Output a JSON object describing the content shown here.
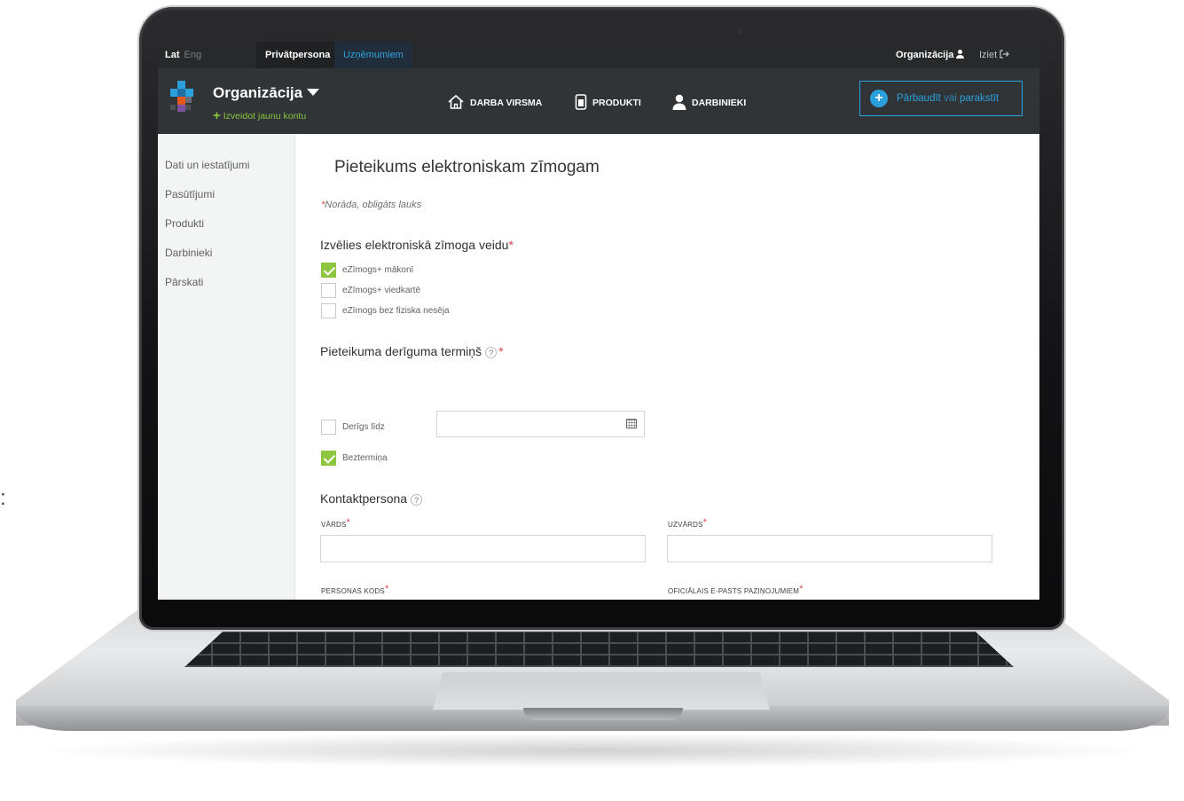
{
  "topbar": {
    "lang_active": "Lat",
    "lang_inactive": "Eng",
    "segment_private": "Privātpersona",
    "segment_business": "Uzņēmumiem",
    "org_label": "Organizācija",
    "exit_label": "Iziet"
  },
  "navbar": {
    "org_name": "Organizācija",
    "new_account": "Izveidot jaunu kontu",
    "nav_items": [
      "DARBA VIRSMA",
      "PRODUKTI",
      "DARBINIEKI"
    ],
    "cta_bold": "Pārbaudīt",
    "cta_connector": "vai",
    "cta_bold2": "parakstīt"
  },
  "sidebar": {
    "items": [
      "Dati un iestatījumi",
      "Pasūtījumi",
      "Produkti",
      "Darbinieki",
      "Pārskati"
    ]
  },
  "form": {
    "title": "Pieteikums elektroniskam zīmogam",
    "required_note": "Norāda, obligāts lauks",
    "required_marker": "*",
    "seal_type": {
      "title": "Izvēlies elektroniskā zīmoga veidu",
      "options": [
        {
          "label": "eZīmogs+ mākonī",
          "checked": true
        },
        {
          "label": "eZīmogs+ viedkartē",
          "checked": false
        },
        {
          "label": "eZīmogs bez fiziska nesēja",
          "checked": false
        }
      ]
    },
    "validity": {
      "title": "Pieteikuma derīguma termiņš",
      "help": "?",
      "until_label": "Derīgs līdz",
      "until_checked": false,
      "date_value": "",
      "unlimited_label": "Beztermiņa",
      "unlimited_checked": true
    },
    "contact": {
      "title": "Kontaktpersona",
      "help": "?",
      "first_name_label": "VĀRDS",
      "last_name_label": "UZVĀRDS",
      "personal_code_label": "PERSONAS KODS",
      "email_label": "OFICIĀLAIS E-PASTS PAZIŅOJUMIEM",
      "first_name_value": "",
      "last_name_value": "",
      "personal_code_value": "",
      "email_value": ""
    }
  },
  "colors": {
    "accent_blue": "#2aa0dc",
    "accent_green": "#8cc63f",
    "required_red": "#e0464a",
    "header_dark": "#303436"
  },
  "icons": {
    "home": "home-icon",
    "products": "device-icon",
    "staff": "user-icon",
    "calendar": "calendar-icon",
    "exit": "exit-icon"
  }
}
